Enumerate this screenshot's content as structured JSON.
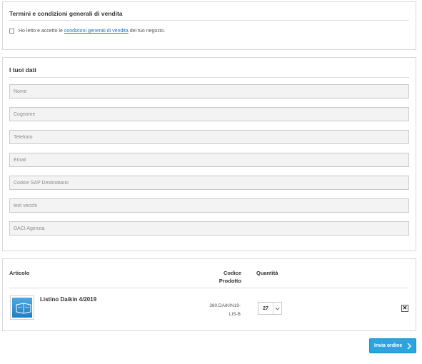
{
  "terms": {
    "title": "Termini e condizioni generali di vendita",
    "text_before": "Ho letto e accetto le",
    "link_text": "condizioni generali di vendita",
    "text_after": "del tuo negozio.",
    "checked": false
  },
  "data_section": {
    "title": "I tuoi dati",
    "fields": {
      "nome": "Nome",
      "cognome": "Cognome",
      "telefono": "Telefono",
      "email": "Email",
      "codice_sap": "Codice SAP Destinatario",
      "test_vecchi": "test vecchi",
      "daci_agenzia": "DACI Agenzia"
    }
  },
  "cart": {
    "col_articolo": "Articolo",
    "col_codice_line1": "Codice",
    "col_codice_line2": "Prodotto",
    "col_quantita": "Quantità",
    "item": {
      "name": "Listino Daikin 4/2019",
      "code_line1": "380.DAIKIN19-",
      "code_line2": "LIS-B",
      "quantity": "27",
      "remove_label": "✕",
      "icon": "book-thumbnail-icon"
    }
  },
  "submit_label": "Invia ordine",
  "colors": {
    "accent": "#2ba5df",
    "link": "#1a73c5"
  }
}
